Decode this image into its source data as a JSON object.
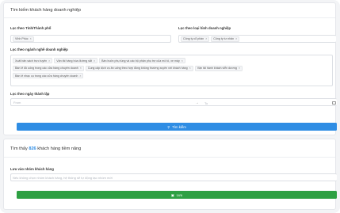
{
  "search_card": {
    "title": "Tìm kiếm khách hàng doanh nghiệp",
    "province": {
      "label": "Lọc theo Tỉnh/Thành phố",
      "selected": [
        "Vĩnh Phúc"
      ]
    },
    "company_type": {
      "label": "Lọc theo loại hình doanh nghiệp",
      "selected": [
        "Công ty cổ phần",
        "Công ty tư nhân"
      ]
    },
    "industry": {
      "label": "Lọc theo ngành nghề doanh nghiệp",
      "rows": [
        [
          "Xuất bản sách trực tuyến",
          "Vận tải hàng hóa đường sắt",
          "Bán buôn phụ tùng và các bộ phận phụ trợ của mô tô, xe máy"
        ],
        [
          "Bán lẻ đồ uống trong các cửa hàng chuyên doanh",
          "Cung cấp dịch vụ ăn uống theo hợp đồng không thường xuyên với khách hàng",
          "Vận tải hành khách viễn dương"
        ],
        [
          "Bán lẻ nhạc cụ trong các cửa hàng chuyên doanh"
        ]
      ]
    },
    "date": {
      "label": "Lọc theo ngày thành lập",
      "from_placeholder": "From",
      "to_placeholder": "To"
    },
    "search_button": "Tìm kiếm"
  },
  "result_card": {
    "prefix": "Tìm thấy",
    "count": "826",
    "suffix": "khách hàng tiềm năng",
    "group": {
      "label": "Lưu vào nhóm khách hàng",
      "placeholder": "Nếu không chọn nhóm khách hàng, hệ thống sẽ tự động tạo nhóm mới"
    },
    "save_button": "Lưu"
  },
  "icons": {
    "search": "search-icon",
    "save": "save-icon",
    "calendar": "calendar-icon",
    "remove": "close-icon"
  },
  "colors": {
    "primary": "#2f8de4",
    "success": "#2ea043"
  }
}
